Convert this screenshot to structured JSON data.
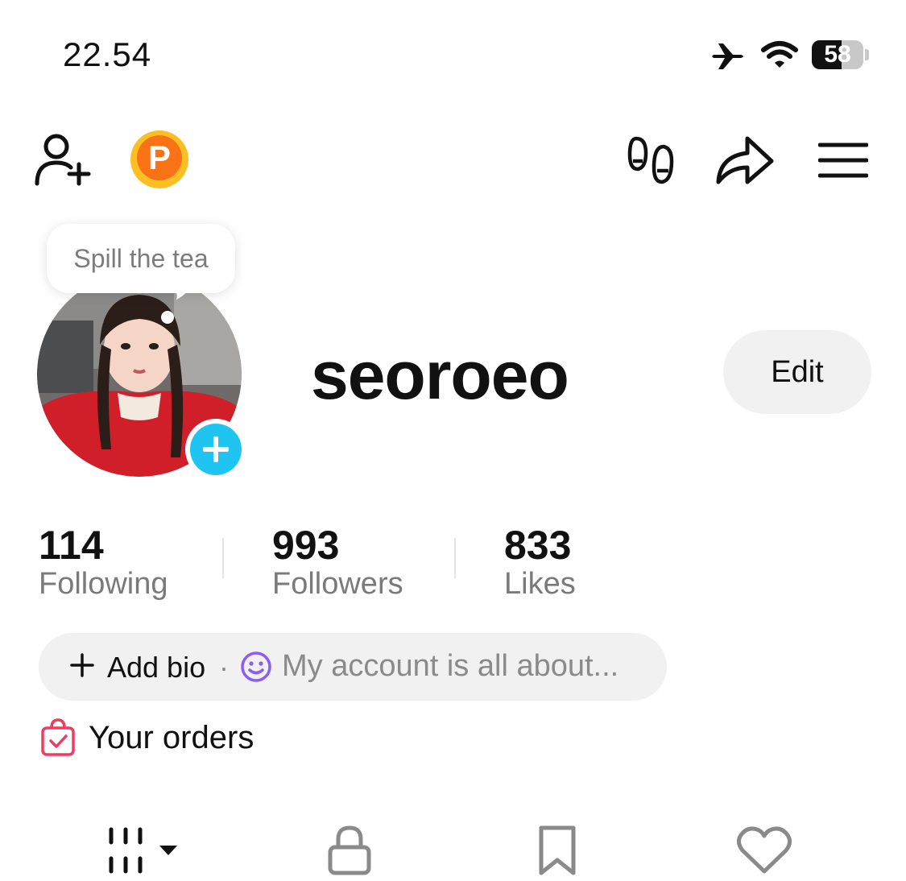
{
  "status_bar": {
    "time": "22.54",
    "battery_percent": "58",
    "battery_level": 0.58,
    "airplane_icon": "airplane-icon",
    "wifi_icon": "wifi-icon"
  },
  "top_bar": {
    "add_friend_icon": "add-friend-icon",
    "coin_letter": "P",
    "footprints_icon": "footprints-icon",
    "share_icon": "share-icon",
    "menu_icon": "hamburger-menu-icon"
  },
  "profile": {
    "note_bubble": "Spill the tea",
    "username": "seoroeo",
    "edit_label": "Edit"
  },
  "stats": [
    {
      "count": "114",
      "label": "Following"
    },
    {
      "count": "993",
      "label": "Followers"
    },
    {
      "count": "833",
      "label": "Likes"
    }
  ],
  "bio": {
    "add_label": "Add bio",
    "separator": "·",
    "hint": "My account is all about..."
  },
  "orders": {
    "label": "Your orders"
  },
  "tabs": [
    "videos-grid-icon",
    "lock-icon",
    "bookmark-icon",
    "heart-icon"
  ],
  "colors": {
    "accent_blue": "#20c4f0",
    "coin_orange": "#f97316",
    "coin_yellow": "#fbbf24",
    "orders_pink": "#ef3b61",
    "smile_purple": "#8b5cf6"
  }
}
